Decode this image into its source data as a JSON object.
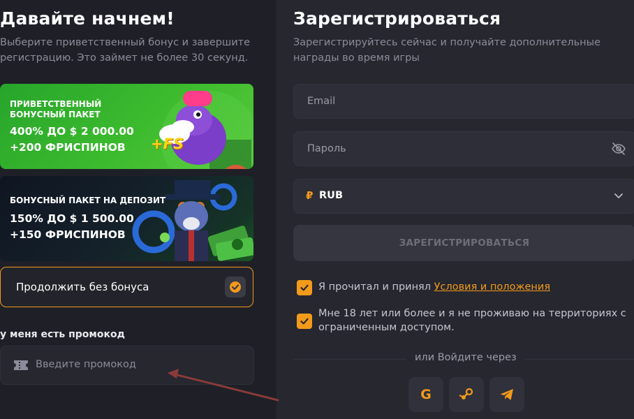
{
  "welcome": {
    "title": "Давайте начнем!",
    "subtitle_line1": "Выберите приветственный бонус и завершите",
    "subtitle_line2": "регистрацию. Это займет не более 30 секунд."
  },
  "bonuses": [
    {
      "title": "ПРИВЕТСТВЕННЫЙ БОНУСНЫЙ ПАКЕТ",
      "amount": "400% ДО $ 2 000.00",
      "spins": "+200 ФРИСПИНОВ",
      "badge": "+FS"
    },
    {
      "title": "БОНУСНЫЙ ПАКЕТ НА ДЕПОЗИТ",
      "amount": "150% ДО $ 1 500.00",
      "spins": "+150 ФРИСПИНОВ"
    }
  ],
  "no_bonus": {
    "label": "Продолжить без бонуса",
    "checked": true
  },
  "promo": {
    "label": "у меня есть промокод",
    "placeholder": "Введите промокод"
  },
  "register": {
    "title": "Зарегистрироваться",
    "subtitle_line1": "Зарегистрируйтесь сейчас и получайте дополнительные",
    "subtitle_line2": "награды во время игры",
    "email_placeholder": "Email",
    "password_placeholder": "Пароль",
    "currency_symbol": "₽",
    "currency": "RUB",
    "button": "ЗАРЕГИСТРИРОВАТЬСЯ"
  },
  "agreements": {
    "terms_prefix": "Я прочитал и принял ",
    "terms_link": "Условия и положения",
    "age_line1": "Мне 18 лет или более и я не проживаю на территориях с",
    "age_line2": "ограниченным доступом."
  },
  "social": {
    "label": "или Войдите через",
    "google": "G",
    "providers": [
      "google-icon",
      "steam-icon",
      "telegram-icon"
    ]
  },
  "colors": {
    "accent": "#f39a1b",
    "background": "#1f2027",
    "panel": "#26272f"
  }
}
